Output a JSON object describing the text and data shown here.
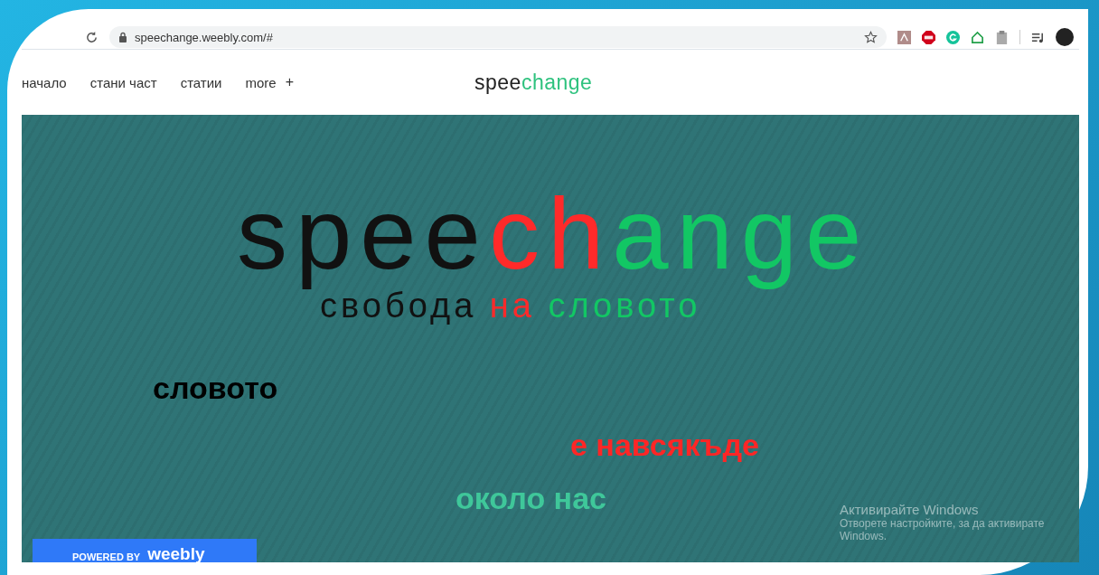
{
  "browser": {
    "url": "speechange.weebly.com/#"
  },
  "nav": {
    "items": [
      {
        "label": "начало"
      },
      {
        "label": "стани част"
      },
      {
        "label": "статии"
      },
      {
        "label": "more"
      }
    ],
    "more_sign": "+"
  },
  "site_logo": [
    {
      "text": "spee",
      "color": "#222222"
    },
    {
      "text": "change",
      "color": "#2ec27e"
    }
  ],
  "hero": {
    "logo": [
      {
        "text": "spee",
        "color": "#111111"
      },
      {
        "text": "ch",
        "color": "#ff2a2a"
      },
      {
        "text": "ange",
        "color": "#12c764"
      }
    ],
    "tagline": [
      {
        "text": "свобода",
        "color": "#111111"
      },
      {
        "text": "на",
        "color": "#ff2a2a"
      },
      {
        "text": "словото",
        "color": "#12c764"
      }
    ],
    "lines": [
      {
        "text": "словото",
        "color": "#000000"
      },
      {
        "text": "е навсякъде",
        "color": "#ff2626"
      },
      {
        "text": "около нас",
        "color": "#3fc79a"
      }
    ]
  },
  "badge": {
    "prefix": "POWERED BY",
    "brand": "weebly"
  },
  "activation": {
    "title": "Активирайте Windows",
    "text": "Отворете настройките, за да активирате Windows."
  }
}
